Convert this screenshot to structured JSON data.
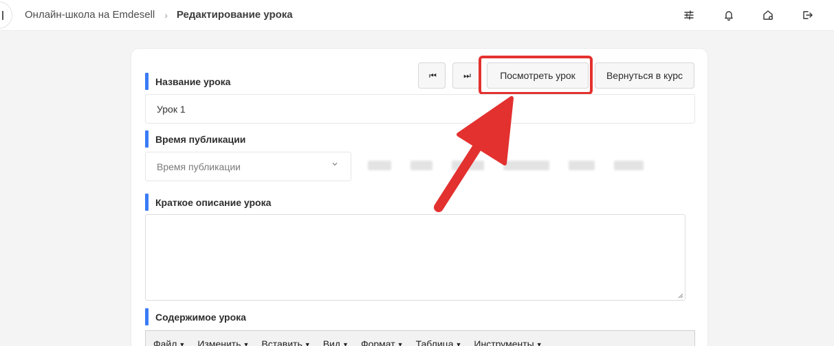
{
  "header": {
    "breadcrumb_root": "Онлайн-школа на Emdesell",
    "breadcrumb_separator": "›",
    "breadcrumb_current": "Редактирование урока",
    "icons": [
      "sliders-icon",
      "bell-icon",
      "home-settings-icon",
      "logout-icon"
    ]
  },
  "toolbar": {
    "prev_label": "⏮",
    "next_label": "⏭",
    "view_lesson_label": "Посмотреть урок",
    "back_to_course_label": "Вернуться в курс"
  },
  "form": {
    "title_label": "Название урока",
    "title_value": "Урок 1",
    "publish_time_label": "Время публикации",
    "publish_time_placeholder": "Время публикации",
    "short_description_label": "Краткое описание урока",
    "content_label": "Содержимое урока"
  },
  "editor": {
    "menu": [
      {
        "label": "Файл"
      },
      {
        "label": "Изменить"
      },
      {
        "label": "Вставить"
      },
      {
        "label": "Вид"
      },
      {
        "label": "Формат"
      },
      {
        "label": "Таблица"
      },
      {
        "label": "Инструменты"
      }
    ],
    "caret": "▼"
  },
  "colors": {
    "accent_bar": "#3b7cf6",
    "highlight": "#e3312f",
    "arrow": "#e3312f"
  }
}
